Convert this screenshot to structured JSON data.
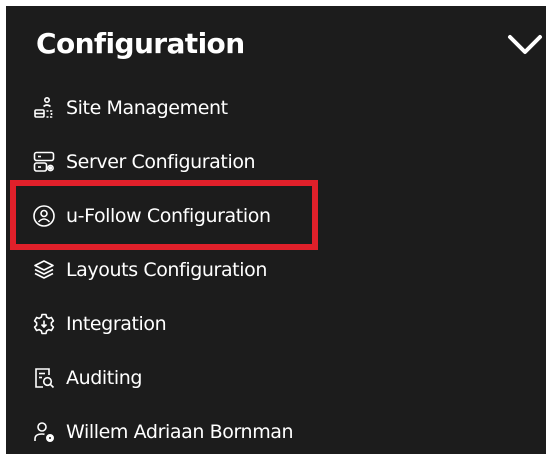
{
  "panel": {
    "title": "Configuration",
    "collapse_icon": "chevron-down-icon"
  },
  "menu": {
    "items": [
      {
        "label": "Site Management",
        "icon": "site-management-icon"
      },
      {
        "label": "Server Configuration",
        "icon": "server-icon"
      },
      {
        "label": "u-Follow Configuration",
        "icon": "user-circle-icon",
        "highlighted": true
      },
      {
        "label": "Layouts Configuration",
        "icon": "layers-icon"
      },
      {
        "label": "Integration",
        "icon": "integration-gear-icon"
      },
      {
        "label": "Auditing",
        "icon": "audit-search-icon"
      },
      {
        "label": "Willem Adriaan Bornman",
        "icon": "user-settings-icon"
      }
    ]
  },
  "colors": {
    "background": "#1c1c1c",
    "text": "#ffffff",
    "highlight_border": "#e0202a"
  }
}
